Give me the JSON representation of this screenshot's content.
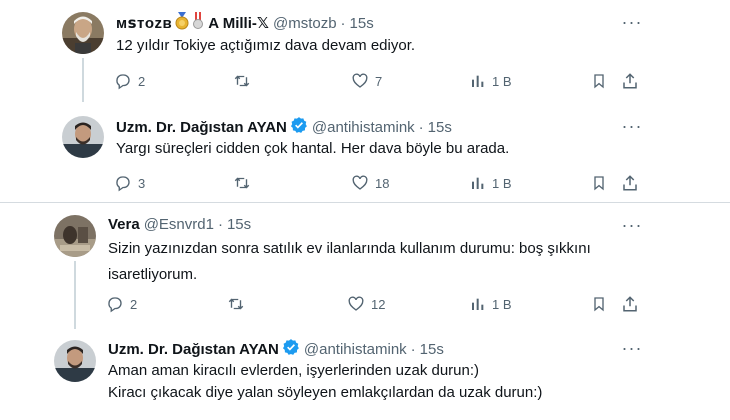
{
  "tweets": [
    {
      "name": "ᴍꜱᴛᴏᴢʙ",
      "name_suffix": "A Milli-𝕏",
      "handle": "@mstozb",
      "time": "15s",
      "text_lines": [
        "12 yıldır Tokiye açtığımız dava devam ediyor."
      ],
      "replies": "2",
      "retweets": "",
      "likes": "7",
      "views": "1 B",
      "verified": false
    },
    {
      "name": "Uzm. Dr. Dağıstan AYAN",
      "handle": "@antihistamink",
      "time": "15s",
      "text_lines": [
        "Yargı süreçleri cidden çok hantal. Her dava böyle bu arada."
      ],
      "replies": "3",
      "retweets": "",
      "likes": "18",
      "views": "1 B",
      "verified": true
    },
    {
      "name": "Vera",
      "handle": "@Esnvrd1",
      "time": "15s",
      "text_lines": [
        "Sizin yazınızdan sonra satılık ev ilanlarında kullanım durumu: boş şıkkını",
        "isaretliyorum."
      ],
      "replies": "2",
      "retweets": "",
      "likes": "12",
      "views": "1 B",
      "verified": false
    },
    {
      "name": "Uzm. Dr. Dağıstan AYAN",
      "handle": "@antihistamink",
      "time": "15s",
      "text_lines": [
        "Aman aman kiracılı evlerden, işyerlerinden uzak durun:)",
        "Kiracı çıkacak diye yalan söyleyen emlakçılardan da uzak durun:)"
      ],
      "verified": true
    }
  ],
  "icons": {
    "reply": "reply-icon",
    "retweet": "retweet-icon",
    "like": "like-icon",
    "views": "views-icon",
    "bookmark": "bookmark-icon",
    "share": "share-icon",
    "more": "more-icon",
    "verified": "verified-badge-icon"
  },
  "colors": {
    "text": "#0f1419",
    "secondary": "#536471",
    "verified": "#1d9bf0",
    "divider": "#d5dbe0",
    "thread_line": "#cfd9de"
  }
}
